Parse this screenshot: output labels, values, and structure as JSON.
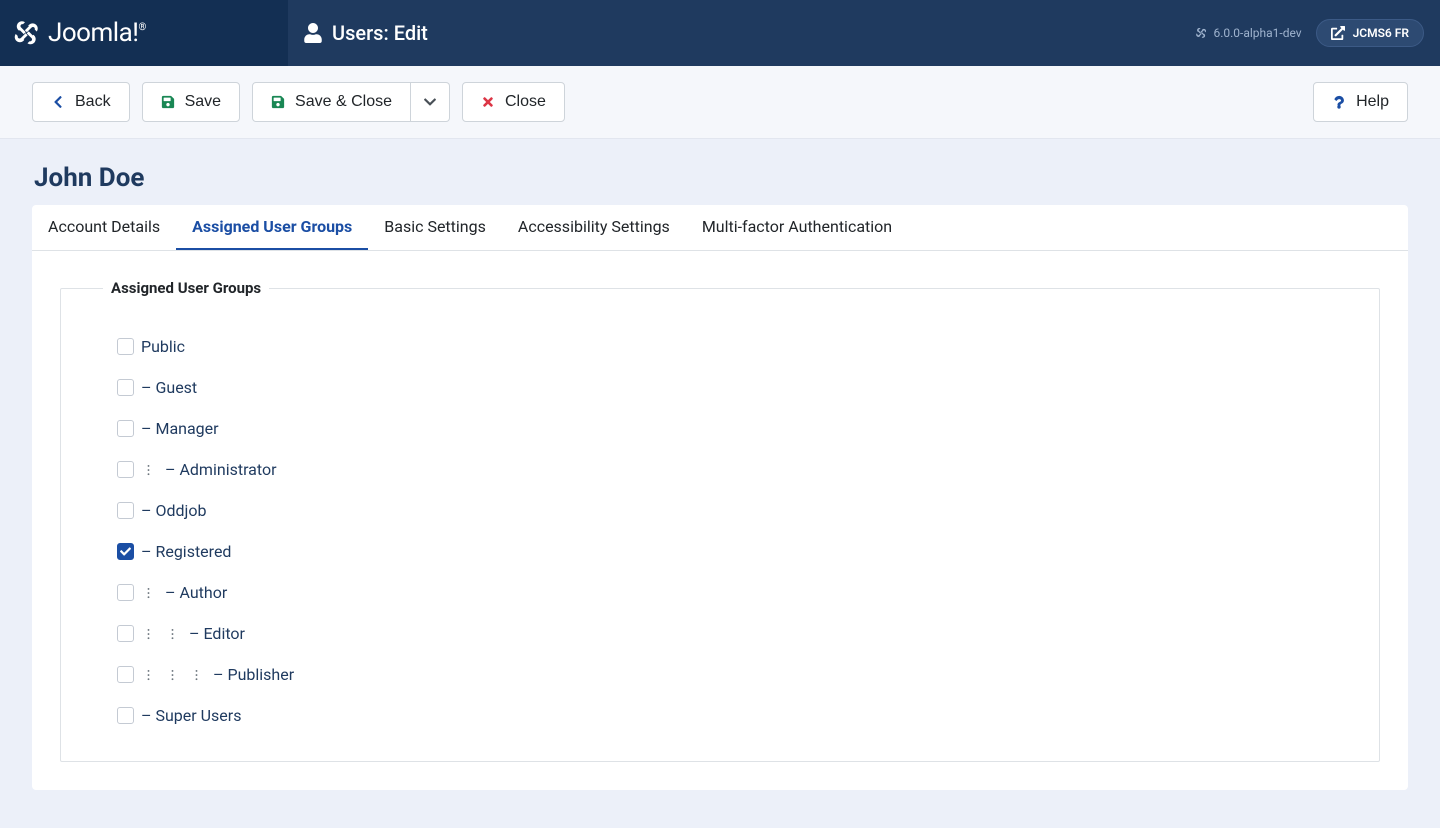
{
  "header": {
    "brand": "Joomla!",
    "title": "Users: Edit",
    "version": "6.0.0-alpha1-dev",
    "site_label": "JCMS6 FR"
  },
  "toolbar": {
    "back": "Back",
    "save": "Save",
    "save_close": "Save & Close",
    "close": "Close",
    "help": "Help"
  },
  "page": {
    "title": "John Doe"
  },
  "tabs": {
    "items": [
      {
        "label": "Account Details",
        "active": false
      },
      {
        "label": "Assigned User Groups",
        "active": true
      },
      {
        "label": "Basic Settings",
        "active": false
      },
      {
        "label": "Accessibility Settings",
        "active": false
      },
      {
        "label": "Multi-factor Authentication",
        "active": false
      }
    ]
  },
  "fieldset": {
    "legend": "Assigned User Groups"
  },
  "groups": [
    {
      "label": "Public",
      "depth": 0,
      "checked": false,
      "prefix": ""
    },
    {
      "label": "Guest",
      "depth": 0,
      "checked": false,
      "prefix": "– "
    },
    {
      "label": "Manager",
      "depth": 0,
      "checked": false,
      "prefix": "– "
    },
    {
      "label": "Administrator",
      "depth": 1,
      "checked": false,
      "prefix": "– "
    },
    {
      "label": "Oddjob",
      "depth": 0,
      "checked": false,
      "prefix": "– "
    },
    {
      "label": "Registered",
      "depth": 0,
      "checked": true,
      "prefix": "– "
    },
    {
      "label": "Author",
      "depth": 1,
      "checked": false,
      "prefix": "– "
    },
    {
      "label": "Editor",
      "depth": 2,
      "checked": false,
      "prefix": "– "
    },
    {
      "label": "Publisher",
      "depth": 3,
      "checked": false,
      "prefix": "– "
    },
    {
      "label": "Super Users",
      "depth": 0,
      "checked": false,
      "prefix": "– "
    }
  ]
}
